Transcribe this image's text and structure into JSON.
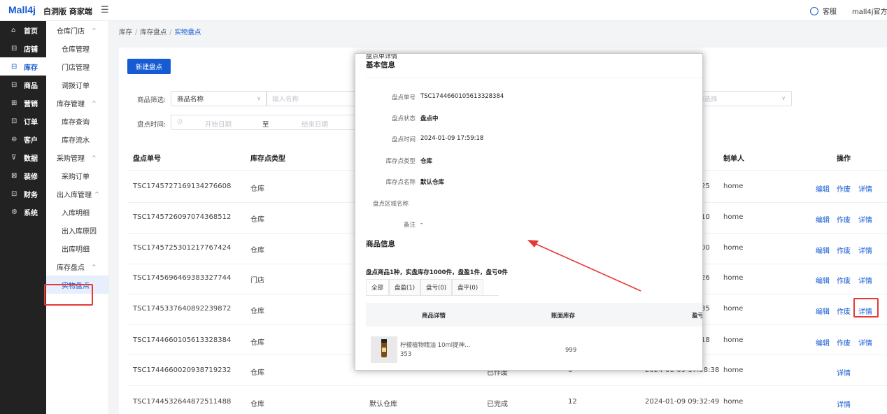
{
  "topbar": {
    "logo": "Mall4j",
    "subtitle": "白洞版 商家端",
    "menu_toggle": "☰",
    "service": "客服",
    "account": "mall4j官方店"
  },
  "nav": [
    {
      "label": "首页",
      "icon": "⌂"
    },
    {
      "label": "店铺",
      "icon": "⊟"
    },
    {
      "label": "库存",
      "icon": "⊟"
    },
    {
      "label": "商品",
      "icon": "⊟"
    },
    {
      "label": "营销",
      "icon": "⊞"
    },
    {
      "label": "订单",
      "icon": "⊡"
    },
    {
      "label": "客户",
      "icon": "⊜"
    },
    {
      "label": "数据",
      "icon": "⊽"
    },
    {
      "label": "装修",
      "icon": "⊠"
    },
    {
      "label": "财务",
      "icon": "⊡"
    },
    {
      "label": "系统",
      "icon": "⚙"
    }
  ],
  "subnav": {
    "g1": "仓库门店",
    "g1_1": "仓库管理",
    "g1_2": "门店管理",
    "g1_3": "调拨订单",
    "g2": "库存管理",
    "g2_1": "库存查询",
    "g2_2": "库存流水",
    "g3": "采购管理",
    "g3_1": "采购订单",
    "g4": "出入库管理",
    "g4_1": "入库明细",
    "g4_2": "出入库原因",
    "g4_3": "出库明细",
    "g5": "库存盘点",
    "g5_1": "实物盘点"
  },
  "breadcrumb": {
    "a": "库存",
    "b": "库存盘点",
    "c": "实物盘点"
  },
  "toolbar": {
    "new": "新建盘点"
  },
  "filters": {
    "product_label": "商品筛选:",
    "product_select": "商品名称",
    "product_placeholder": "输入名称",
    "time_label": "盘点时间:",
    "start": "开始日期",
    "to": "至",
    "end": "结束日期",
    "right_select": "请选择"
  },
  "table": {
    "h_no": "盘点单号",
    "h_type": "库存点类型",
    "h_maker": "制单人",
    "h_op": "操作",
    "edit": "编辑",
    "void": "作废",
    "detail": "详情",
    "rows": [
      {
        "no": "TSC1745727169134276608",
        "type": "仓库",
        "time": "25",
        "maker": "home"
      },
      {
        "no": "TSC1745726097074368512",
        "type": "仓库",
        "time": "10",
        "maker": "home"
      },
      {
        "no": "TSC1745725301217767424",
        "type": "仓库",
        "time": "00",
        "maker": "home"
      },
      {
        "no": "TSC1745696469383327744",
        "type": "门店",
        "time": "26",
        "maker": "home"
      },
      {
        "no": "TSC1745337640892239872",
        "type": "仓库",
        "time": "35",
        "maker": "home"
      },
      {
        "no": "TSC1744660105613328384",
        "type": "仓库",
        "time": "18",
        "maker": "home"
      },
      {
        "no": "TSC1744660020938719232",
        "type": "仓库",
        "point": "-",
        "status": "已作废",
        "qty": "0",
        "time": "2024-01-09 17:58:38",
        "maker": "home"
      },
      {
        "no": "TSC1744532644872511488",
        "type": "仓库",
        "point": "默认仓库",
        "status": "已完成",
        "qty": "12",
        "time": "2024-01-09 09:32:49",
        "maker": "home"
      }
    ]
  },
  "modal": {
    "title": "盘点单详情",
    "basic": "基本信息",
    "l_no": "盘点单号",
    "v_no": "TSC1744660105613328384",
    "l_status": "盘点状态",
    "v_status": "盘点中",
    "l_time": "盘点时间",
    "v_time": "2024-01-09 17:59:18",
    "l_ptype": "库存点类型",
    "v_ptype": "仓库",
    "l_pname": "库存点名称",
    "v_pname": "默认仓库",
    "l_area": "盘点区域名称",
    "l_note": "备注",
    "v_note": "-",
    "goods": "商品信息",
    "summary": "盘点商品1种，实盘库存1000件，盘盈1件，盘亏0件",
    "tabs": [
      "全部",
      "盘盈(1)",
      "盘亏(0)",
      "盘平(0)"
    ],
    "th_detail": "商品详情",
    "th_stock": "账面库存",
    "th_profit": "盈亏",
    "prod_name": "柠檬植物精油 10ml提神...",
    "prod_code": "353",
    "prod_stock": "999"
  },
  "colors": {
    "accent": "#155bd4",
    "highlight": "#e53935"
  }
}
